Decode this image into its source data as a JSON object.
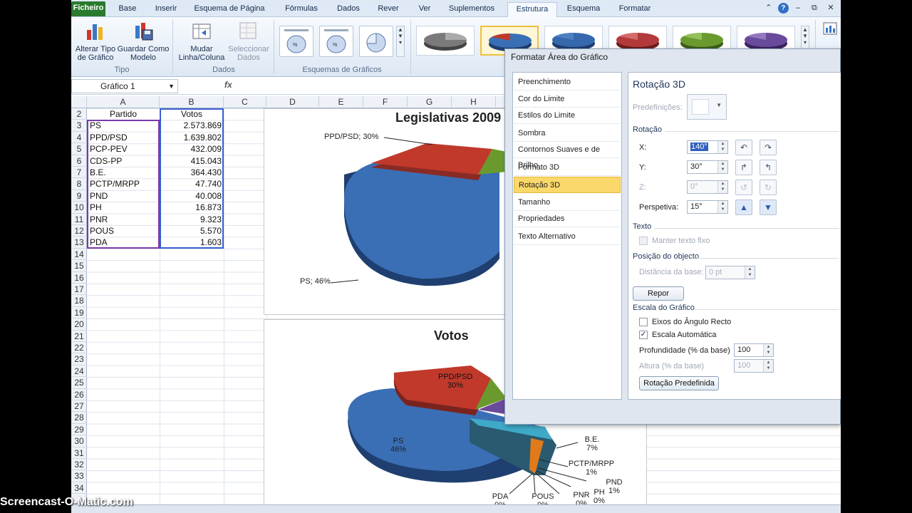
{
  "tabs": [
    "Ficheiro",
    "Base",
    "Inserir",
    "Esquema de Página",
    "Fórmulas",
    "Dados",
    "Rever",
    "Ver",
    "Suplementos",
    "Estrutura",
    "Esquema",
    "Formatar"
  ],
  "ribbon": {
    "change_chart_type": "Alterar Tipo de Gráfico",
    "save_template": "Guardar Como Modelo",
    "group_tipo": "Tipo",
    "switch_row_col": "Mudar Linha/Coluna",
    "select_data": "Seleccionar Dados",
    "group_dados": "Dados",
    "group_layouts": "Esquemas de Gráficos",
    "style_colors": [
      "#606060",
      "#c0392b",
      "#2f5d9a",
      "#b33a3a",
      "#6a9a2e",
      "#6a4a9a"
    ]
  },
  "formula_bar": {
    "name_box": "Gráfico 1",
    "fx": "fx"
  },
  "columns": [
    "A",
    "B",
    "C",
    "D",
    "E",
    "F",
    "G",
    "H"
  ],
  "rows": [
    "2",
    "3",
    "4",
    "5",
    "6",
    "7",
    "8",
    "9",
    "10",
    "11",
    "12",
    "13",
    "14",
    "15",
    "16",
    "17",
    "18",
    "19",
    "20",
    "21",
    "22",
    "23",
    "24",
    "25",
    "26",
    "27",
    "28",
    "29",
    "30",
    "31",
    "32",
    "33",
    "34"
  ],
  "table": {
    "header": [
      "Partido",
      "Votos"
    ],
    "rows": [
      [
        "PS",
        "2.573.869"
      ],
      [
        "PPD/PSD",
        "1.639.802"
      ],
      [
        "PCP-PEV",
        "432.009"
      ],
      [
        "CDS-PP",
        "415.043"
      ],
      [
        "B.E.",
        "364.430"
      ],
      [
        "PCTP/MRPP",
        "47.740"
      ],
      [
        "PND",
        "40.008"
      ],
      [
        "PH",
        "16.873"
      ],
      [
        "PNR",
        "9.323"
      ],
      [
        "POUS",
        "5.570"
      ],
      [
        "PDA",
        "1.603"
      ]
    ]
  },
  "chart1": {
    "title": "Legislativas 2009",
    "label_ppd": "PPD/PSD; 30%",
    "label_ps": "PS; 46%"
  },
  "chart2": {
    "title": "Votos",
    "labels": {
      "ppd": "PPD/PSD",
      "ppd_pct": "30%",
      "ps": "PS",
      "ps_pct": "46%",
      "be": "B.E.",
      "be_pct": "7%",
      "pctp": "PCTP/MRPP",
      "pctp_pct": "1%",
      "pnd": "PND",
      "pnd_pct": "1%",
      "ph": "PH",
      "ph_pct": "0%",
      "pnr": "PNR",
      "pnr_pct": "0%",
      "pous": "POUS",
      "pous_pct": "0%",
      "pda": "PDA",
      "pda_pct": "0%"
    }
  },
  "dialog": {
    "title": "Formatar Área do Gráfico",
    "nav": [
      "Preenchimento",
      "Cor do Limite",
      "Estilos do Limite",
      "Sombra",
      "Contornos Suaves e de Brilho",
      "Formato 3D",
      "Rotação 3D",
      "Tamanho",
      "Propriedades",
      "Texto Alternativo"
    ],
    "heading": "Rotação 3D",
    "predefinicoes": "Predefinições:",
    "rotacao": "Rotação",
    "x_label": "X:",
    "x_value": "140°",
    "y_label": "Y:",
    "y_value": "30°",
    "z_label": "Z:",
    "z_value": "0°",
    "perspectiva_label": "Perspetiva:",
    "perspectiva_value": "15°",
    "texto": "Texto",
    "manter_texto": "Manter texto fixo",
    "posicao": "Posição do objecto",
    "distancia_label": "Distância da base:",
    "distancia_value": "0 pt",
    "repor": "Repor",
    "escala": "Escala do Gráfico",
    "eixos": "Eixos do Ângulo Recto",
    "escala_auto": "Escala Automática",
    "profundidade_label": "Profundidade (% da base)",
    "profundidade_value": "100",
    "altura_label": "Altura (% da base)",
    "altura_value": "100",
    "rotacao_predef": "Rotação Predefinida"
  },
  "watermark": "Screencast-O-Matic.com"
}
